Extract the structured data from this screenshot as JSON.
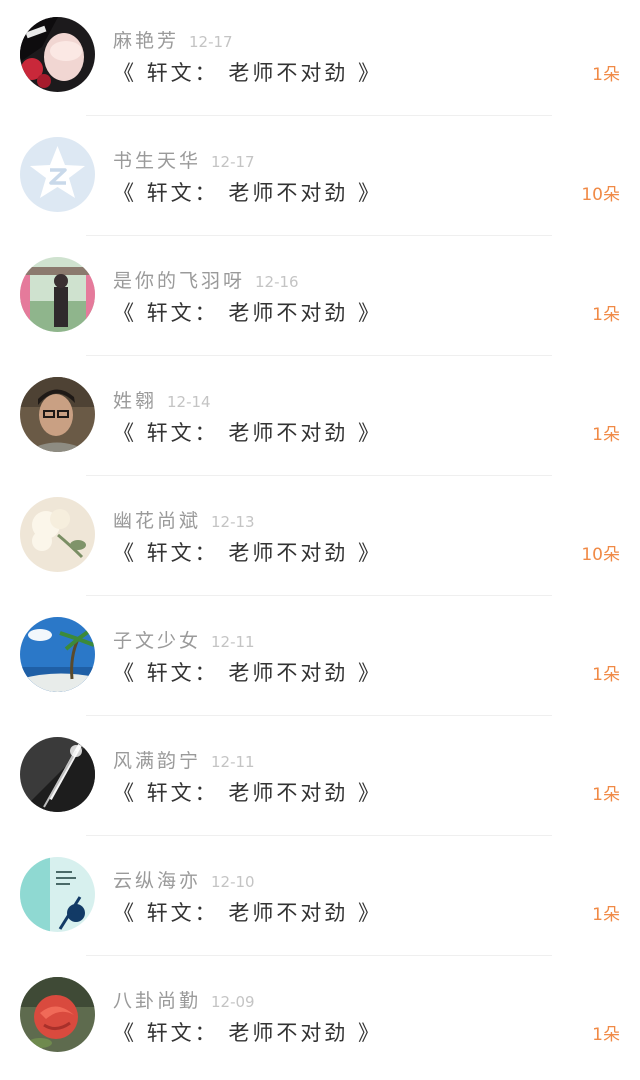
{
  "colors": {
    "accent": "#f08a46",
    "name_text": "#9a9a9a",
    "date_text": "#c4c4c4",
    "title_text": "#333333",
    "divider": "#efefef"
  },
  "items": [
    {
      "name": "麻艳芳",
      "date": "12-17",
      "title": "《 轩文： 老师不对劲 》",
      "count": "1朵",
      "avatar": "dark-portrait"
    },
    {
      "name": "书生天华",
      "date": "12-17",
      "title": "《 轩文： 老师不对劲 》",
      "count": "10朵",
      "avatar": "qq-star-default"
    },
    {
      "name": "是你的飞羽呀",
      "date": "12-16",
      "title": "《 轩文： 老师不对劲 》",
      "count": "1朵",
      "avatar": "girl-outdoor"
    },
    {
      "name": "姓翱",
      "date": "12-14",
      "title": "《 轩文： 老师不对劲 》",
      "count": "1朵",
      "avatar": "man-selfie"
    },
    {
      "name": "幽花尚斌",
      "date": "12-13",
      "title": "《 轩文： 老师不对劲 》",
      "count": "10朵",
      "avatar": "white-flowers"
    },
    {
      "name": "子文少女",
      "date": "12-11",
      "title": "《 轩文： 老师不对劲 》",
      "count": "1朵",
      "avatar": "beach-palm"
    },
    {
      "name": "风满韵宁",
      "date": "12-11",
      "title": "《 轩文： 老师不对劲 》",
      "count": "1朵",
      "avatar": "bw-light"
    },
    {
      "name": "云纵海亦",
      "date": "12-10",
      "title": "《 轩文： 老师不对劲 》",
      "count": "1朵",
      "avatar": "teal-illustration"
    },
    {
      "name": "八卦尚勤",
      "date": "12-09",
      "title": "《 轩文： 老师不对劲 》",
      "count": "1朵",
      "avatar": "red-rose"
    }
  ]
}
